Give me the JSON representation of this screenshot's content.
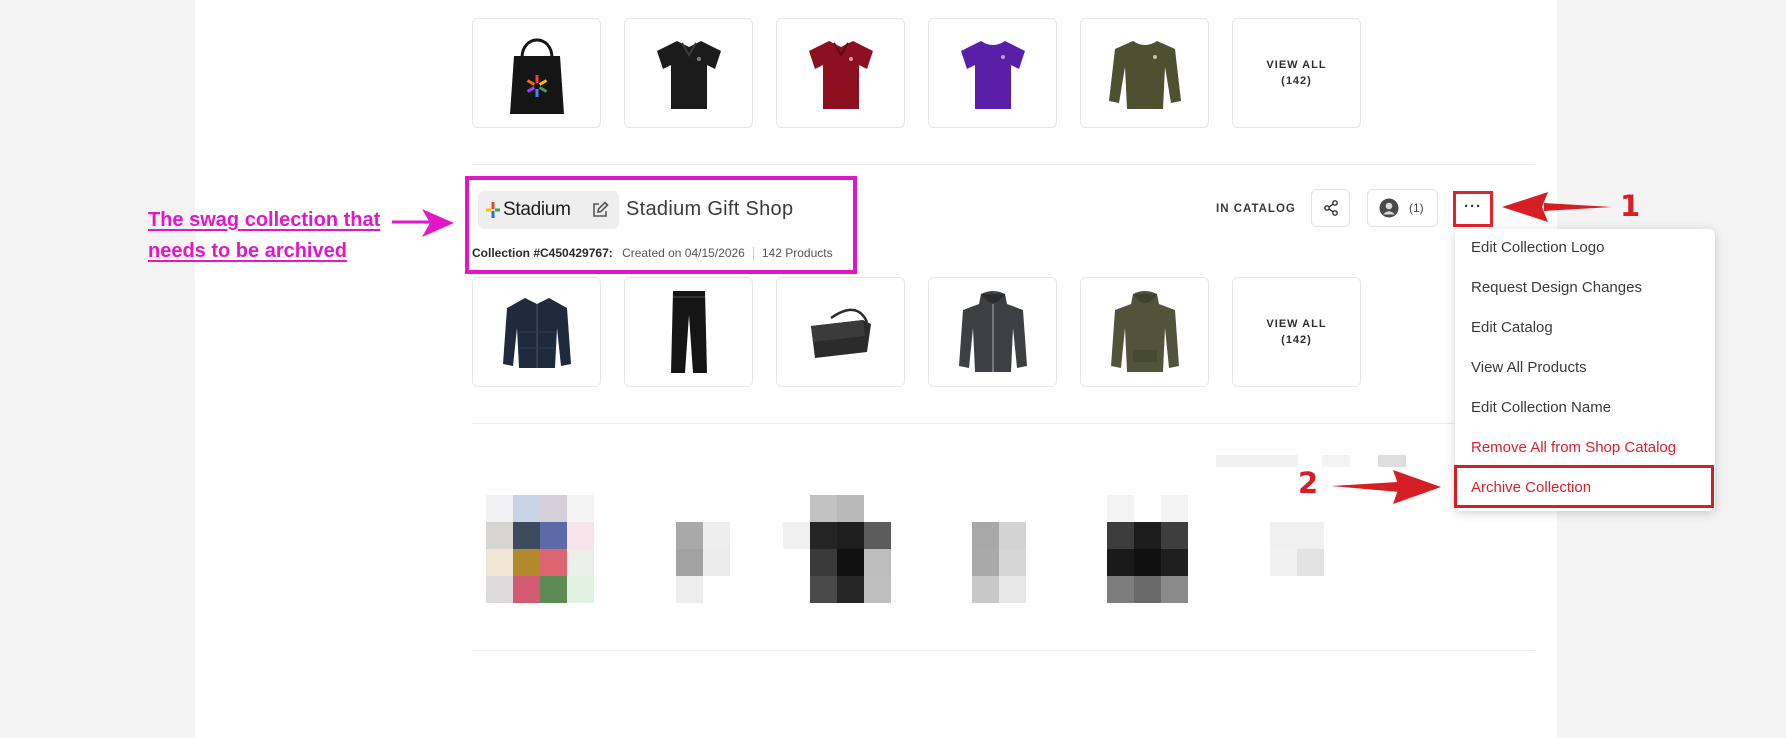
{
  "collection_above": {
    "products": [
      {
        "name": "tote-bag"
      },
      {
        "name": "black-polo"
      },
      {
        "name": "red-polo"
      },
      {
        "name": "purple-tshirt"
      },
      {
        "name": "olive-sweatshirt"
      }
    ],
    "view_all_label": "VIEW ALL",
    "view_all_count": "(142)"
  },
  "collection": {
    "brand_name": "Stadium",
    "title": "Stadium Gift Shop",
    "id_label": "Collection #C450429767:",
    "created_label": "Created on 04/15/2026",
    "product_count_label": "142 Products",
    "status": "IN CATALOG",
    "members_count": "(1)",
    "more_label": "···",
    "products": [
      {
        "name": "navy-jacket"
      },
      {
        "name": "black-pants"
      },
      {
        "name": "messenger-bag"
      },
      {
        "name": "grey-zip-hoodie"
      },
      {
        "name": "olive-hoodie"
      }
    ],
    "view_all_label": "VIEW ALL",
    "view_all_count": "(142)"
  },
  "menu": {
    "items": [
      {
        "label": "Edit Collection Logo",
        "danger": false
      },
      {
        "label": "Request Design Changes",
        "danger": false
      },
      {
        "label": "Edit Catalog",
        "danger": false
      },
      {
        "label": "View All Products",
        "danger": false
      },
      {
        "label": "Edit Collection Name",
        "danger": false
      },
      {
        "label": "Remove All from Shop Catalog",
        "danger": true
      },
      {
        "label": "Archive Collection",
        "danger": true
      }
    ]
  },
  "annotations": {
    "note_line1": "The swag collection that",
    "note_line2": "needs to be archived",
    "step1": "1",
    "step2": "2",
    "note_color": "#e317c8",
    "step_color": "#d51f24"
  },
  "icons": {
    "edit": "pencil-square-icon",
    "share": "share-icon",
    "user": "user-avatar-icon"
  },
  "colors": {
    "danger": "#d8202f",
    "panel": "#ffffff",
    "background": "#f3f3f4"
  }
}
